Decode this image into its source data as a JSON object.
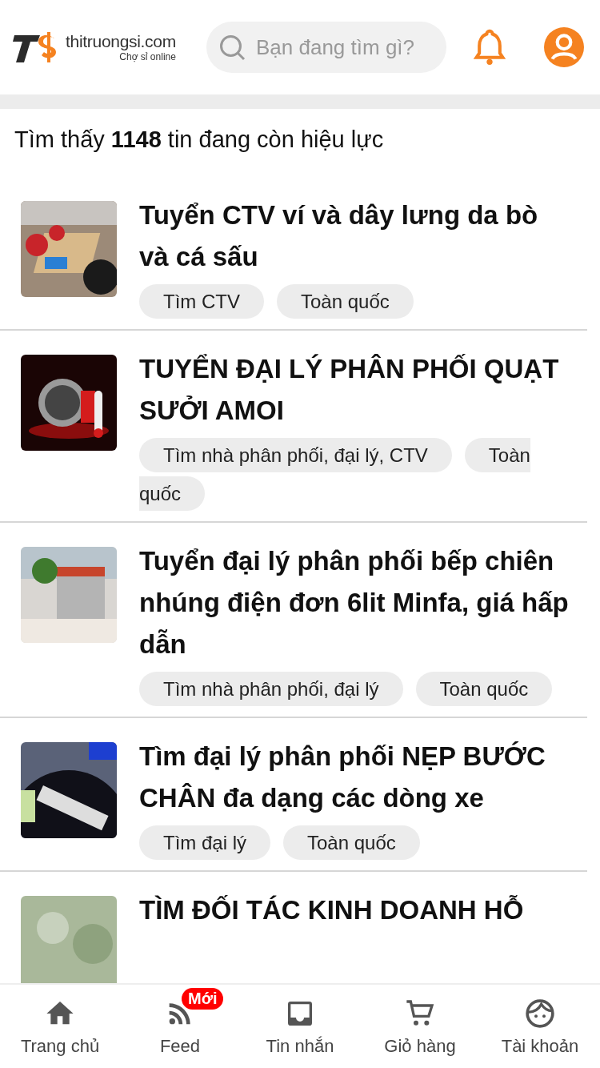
{
  "header": {
    "logo_name": "thitruongsi.com",
    "logo_tagline": "Chợ sỉ online",
    "search": {
      "placeholder": "Bạn đang tìm gì?"
    }
  },
  "result_count": "Tìm thấy **1148** tin đang còn hiệu lực",
  "listings": [
    {
      "title": "Tuyển CTV ví và dây lưng da bò và cá sấu",
      "tags": [
        "Tìm CTV",
        "Toàn quốc"
      ]
    },
    {
      "title": "TUYỂN ĐẠI LÝ PHÂN PHỐI QUẠT SƯỞI AMOI",
      "tags": [
        "Tìm nhà phân phối, đại lý, CTV",
        "Toàn quốc"
      ]
    },
    {
      "title": "Tuyển đại lý phân phối bếp chiên nhúng điện đơn 6lit Minfa, giá hấp dẫn",
      "tags": [
        "Tìm nhà phân phối, đại lý",
        "Toàn quốc"
      ]
    },
    {
      "title": "Tìm đại lý phân phối NẸP BƯỚC CHÂN đa dạng các dòng xe",
      "tags": [
        "Tìm đại lý",
        "Toàn quốc"
      ]
    },
    {
      "title": "TÌM ĐỐI TÁC KINH DOANH HỖ"
    }
  ],
  "bottom_nav": [
    {
      "kind": "home",
      "label": "Trang chủ"
    },
    {
      "kind": "feed",
      "label": "Feed",
      "badge": "Mới"
    },
    {
      "kind": "inbox",
      "label": "Tin nhắn"
    },
    {
      "kind": "cart",
      "label": "Giỏ hàng"
    },
    {
      "kind": "account",
      "label": "Tài khoản"
    }
  ]
}
